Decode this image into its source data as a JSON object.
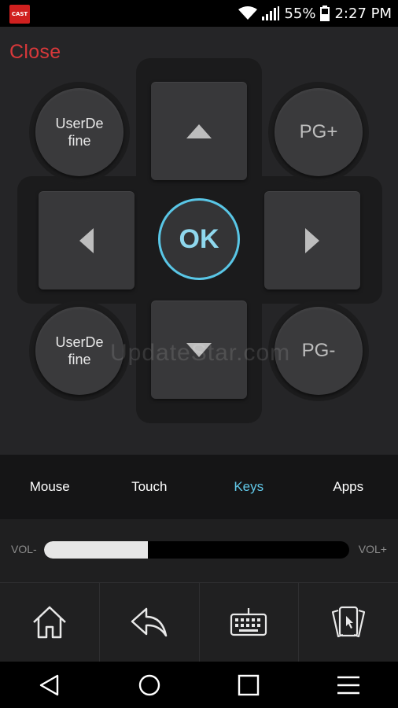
{
  "status_bar": {
    "app_badge": "CAST",
    "battery": "55%",
    "time": "2:27 PM",
    "icons": [
      "wifi-icon",
      "signal-icon",
      "battery-icon"
    ]
  },
  "remote": {
    "close_label": "Close",
    "userdefine_top": "UserDe fine",
    "userdefine_bottom": "UserDe fine",
    "pg_up": "PG+",
    "pg_down": "PG-",
    "ok_label": "OK",
    "watermark": "UpdateStar.com"
  },
  "tabs": [
    {
      "label": "Mouse",
      "active": false
    },
    {
      "label": "Touch",
      "active": false
    },
    {
      "label": "Keys",
      "active": true
    },
    {
      "label": "Apps",
      "active": false
    }
  ],
  "volume": {
    "minus_label": "VOL-",
    "plus_label": "VOL+",
    "level": 0.34
  },
  "actions": [
    "home-icon",
    "back-arrow-icon",
    "keyboard-icon",
    "cards-touch-icon"
  ],
  "nav": [
    "back-triangle-icon",
    "home-circle-icon",
    "recents-square-icon",
    "menu-icon"
  ],
  "colors": {
    "accent": "#59c6e6",
    "close": "#d8383a",
    "badge": "#d0201f"
  }
}
